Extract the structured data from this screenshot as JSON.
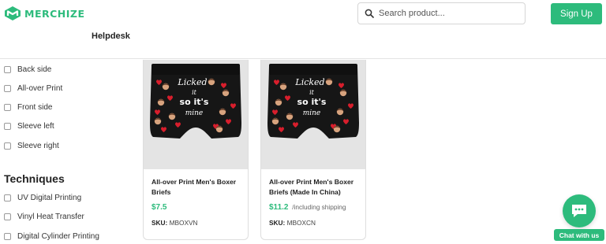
{
  "header": {
    "brand": "MERCHIZE",
    "search_placeholder": "Search product...",
    "signup_label": "Sign Up",
    "helpdesk_label": "Helpdesk"
  },
  "sidebar": {
    "sides": [
      "Back side",
      "All-over Print",
      "Front side",
      "Sleeve left",
      "Sleeve right"
    ],
    "techniques_title": "Techniques",
    "techniques": [
      "UV Digital Printing",
      "Vinyl Heat Transfer",
      "Digital Cylinder Printing"
    ]
  },
  "products": [
    {
      "title": "All-over Print Men's Boxer Briefs",
      "price": "$7.5",
      "price_note": "",
      "sku_label": "SKU:",
      "sku": "MBOXVN",
      "print_text": [
        "Licked",
        "it",
        "so it's",
        "mine"
      ]
    },
    {
      "title": "All-over Print Men's Boxer Briefs (Made In China)",
      "price": "$11.2",
      "price_note": "/including shipping",
      "sku_label": "SKU:",
      "sku": "MBOXCN",
      "print_text": [
        "Licked",
        "it",
        "so it's",
        "mine"
      ]
    }
  ],
  "chat": {
    "label": "Chat with us",
    "icon": "chat-bubble-icon"
  },
  "colors": {
    "brand_green": "#2dbb7c",
    "boxer_black": "#161616",
    "heart_red": "#d81e2c"
  }
}
